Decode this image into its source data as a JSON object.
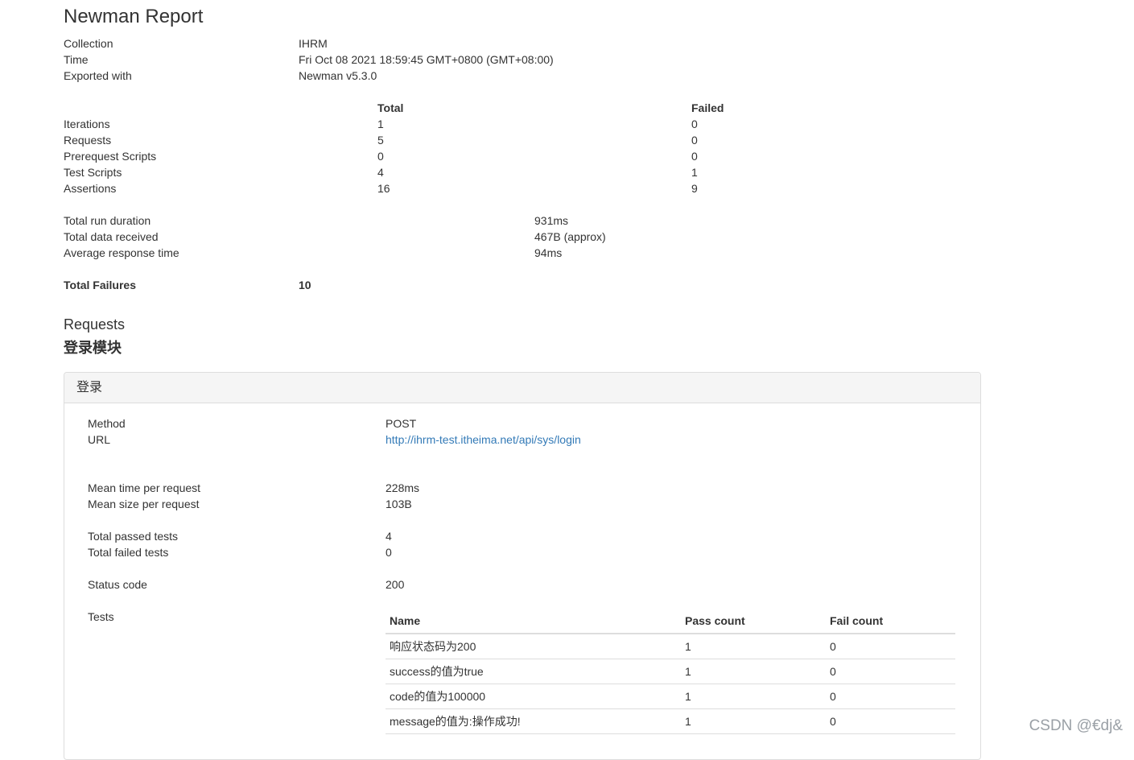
{
  "report": {
    "title": "Newman Report",
    "info": [
      {
        "label": "Collection",
        "value": "IHRM"
      },
      {
        "label": "Time",
        "value": "Fri Oct 08 2021 18:59:45 GMT+0800 (GMT+08:00)"
      },
      {
        "label": "Exported with",
        "value": "Newman v5.3.0"
      }
    ],
    "summary": {
      "headers": {
        "total": "Total",
        "failed": "Failed"
      },
      "rows": [
        {
          "label": "Iterations",
          "total": "1",
          "failed": "0"
        },
        {
          "label": "Requests",
          "total": "5",
          "failed": "0"
        },
        {
          "label": "Prerequest Scripts",
          "total": "0",
          "failed": "0"
        },
        {
          "label": "Test Scripts",
          "total": "4",
          "failed": "1"
        },
        {
          "label": "Assertions",
          "total": "16",
          "failed": "9"
        }
      ]
    },
    "timings": [
      {
        "label": "Total run duration",
        "value": "931ms"
      },
      {
        "label": "Total data received",
        "value": "467B (approx)"
      },
      {
        "label": "Average response time",
        "value": "94ms"
      }
    ],
    "total_failures": {
      "label": "Total Failures",
      "value": "10"
    },
    "requests_heading": "Requests",
    "folder_name": "登录模块"
  },
  "request_panel": {
    "title": "登录",
    "method": {
      "label": "Method",
      "value": "POST"
    },
    "url": {
      "label": "URL",
      "value": "http://ihrm-test.itheima.net/api/sys/login"
    },
    "mean_time": {
      "label": "Mean time per request",
      "value": "228ms"
    },
    "mean_size": {
      "label": "Mean size per request",
      "value": "103B"
    },
    "passed": {
      "label": "Total passed tests",
      "value": "4"
    },
    "failed": {
      "label": "Total failed tests",
      "value": "0"
    },
    "status": {
      "label": "Status code",
      "value": "200"
    },
    "tests_label": "Tests",
    "tests": {
      "headers": {
        "name": "Name",
        "pass": "Pass count",
        "fail": "Fail count"
      },
      "rows": [
        {
          "name": "响应状态码为200",
          "pass": "1",
          "fail": "0"
        },
        {
          "name": "success的值为true",
          "pass": "1",
          "fail": "0"
        },
        {
          "name": "code的值为100000",
          "pass": "1",
          "fail": "0"
        },
        {
          "name": "message的值为:操作成功!",
          "pass": "1",
          "fail": "0"
        }
      ]
    }
  },
  "watermark": "CSDN @€dj&"
}
